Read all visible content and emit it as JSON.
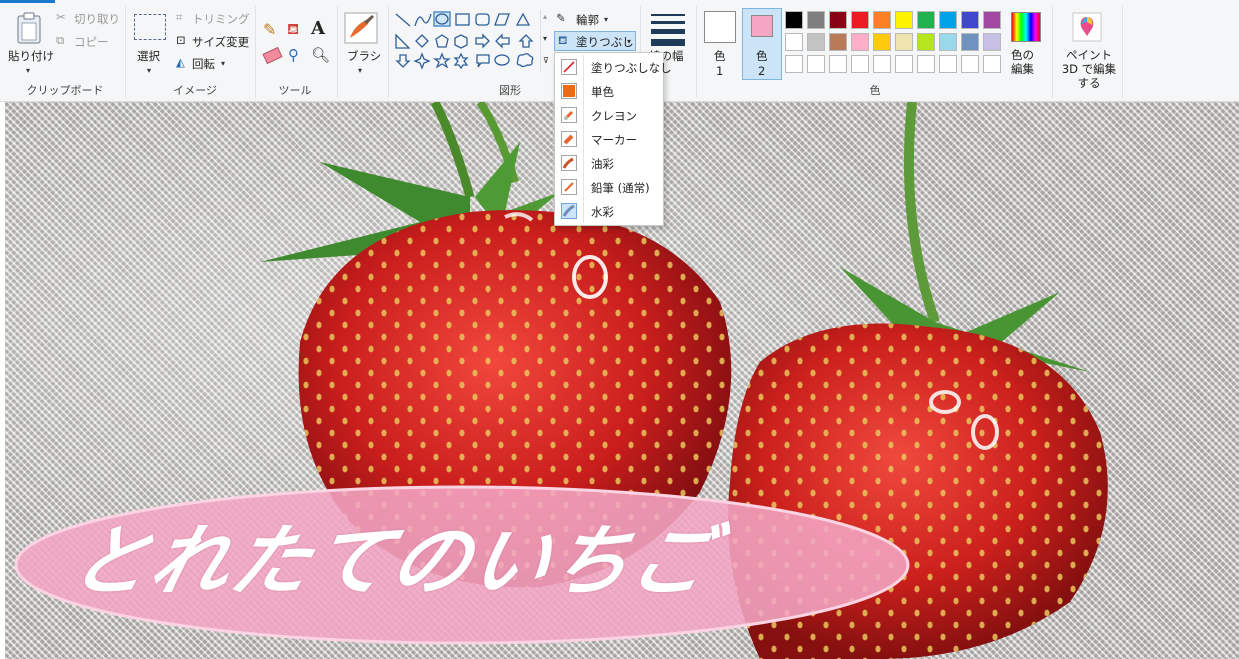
{
  "ribbon": {
    "clipboard": {
      "paste_label": "貼り付け",
      "cut_label": "切り取り",
      "copy_label": "コピー",
      "group_label": "クリップボード"
    },
    "image": {
      "select_label": "選択",
      "crop_label": "トリミング",
      "resize_label": "サイズ変更",
      "rotate_label": "回転",
      "group_label": "イメージ"
    },
    "tools": {
      "group_label": "ツール"
    },
    "brush": {
      "label": "ブラシ"
    },
    "shapes": {
      "outline_label": "輪郭",
      "fill_label": "塗りつぶし",
      "group_label": "図形"
    },
    "size": {
      "label": "線の幅"
    },
    "colors": {
      "color1_label": "色",
      "color1_num": "1",
      "color2_label": "色",
      "color2_num": "2",
      "color1_value": "#ffffff",
      "color2_value": "#f4a6c4",
      "edit_colors_label": "色の編集",
      "paint3d_label": "ペイント 3D で編集する",
      "group_label": "色",
      "palette_row1": [
        "#000000",
        "#7f7f7f",
        "#880015",
        "#ed1c24",
        "#ff7f27",
        "#fff200",
        "#22b14c",
        "#00a2e8",
        "#3f48cc",
        "#a349a4"
      ],
      "palette_row2": [
        "#ffffff",
        "#c3c3c3",
        "#b97a57",
        "#ffaec9",
        "#ffc90e",
        "#efe4b0",
        "#b5e61d",
        "#99d9ea",
        "#7092be",
        "#c8bfe7"
      ],
      "palette_row3": [
        "#ffffff",
        "#ffffff",
        "#ffffff",
        "#ffffff",
        "#ffffff",
        "#ffffff",
        "#ffffff",
        "#ffffff",
        "#ffffff",
        "#ffffff"
      ]
    }
  },
  "fill_menu": {
    "items": [
      {
        "label": "塗りつぶしなし",
        "icon": "no-fill-icon"
      },
      {
        "label": "単色",
        "icon": "solid-color-icon"
      },
      {
        "label": "クレヨン",
        "icon": "crayon-icon"
      },
      {
        "label": "マーカー",
        "icon": "marker-icon"
      },
      {
        "label": "油彩",
        "icon": "oil-icon"
      },
      {
        "label": "鉛筆 (通常)",
        "icon": "pencil-natural-icon"
      },
      {
        "label": "水彩",
        "icon": "watercolor-icon"
      }
    ],
    "selected": "水彩"
  },
  "canvas": {
    "banner_text": "とれたてのいちご",
    "banner_color": "#f4a6c4"
  }
}
